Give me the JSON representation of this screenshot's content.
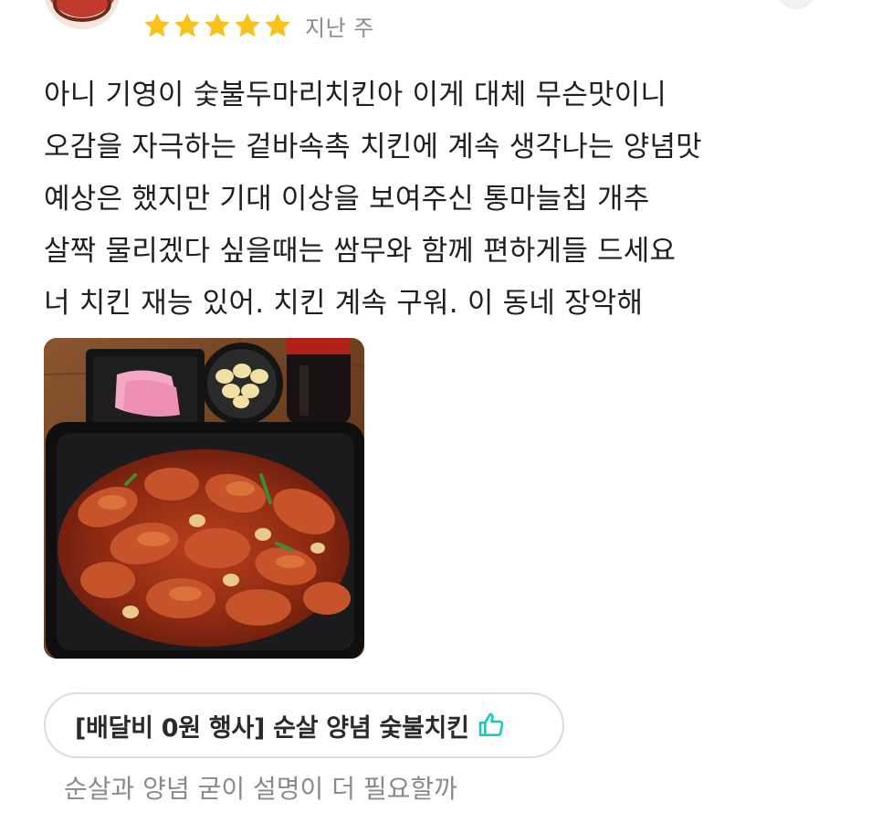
{
  "reviewer": {
    "avatar_icon": "avatar-icon"
  },
  "rating": {
    "stars": 5,
    "max_stars": 5,
    "star_color": "#F9C21A",
    "time_label": "지난 주"
  },
  "review": {
    "lines": [
      "아니 기영이 숯불두마리치킨아 이게 대체 무슨맛이니",
      "오감을 자극하는 겉바속촉 치킨에 계속 생각나는 양념맛",
      "예상은 했지만 기대 이상을 보여주신 통마늘칩 개추",
      "살짝 물리겠다 싶을때는 쌈무와 함께 편하게들 드세요",
      "너 치킨 재능 있어. 치킨 계속 구워. 이 동네 장악해"
    ]
  },
  "photo": {
    "icon": "food-photo"
  },
  "menu": {
    "label": "[배달비 0원 행사] 순살 양념 숯불치킨",
    "like_icon": "thumbs-up-icon",
    "like_color": "#22C7B8",
    "caption": "순살과 양념 굳이 설명이 더 필요할까"
  }
}
